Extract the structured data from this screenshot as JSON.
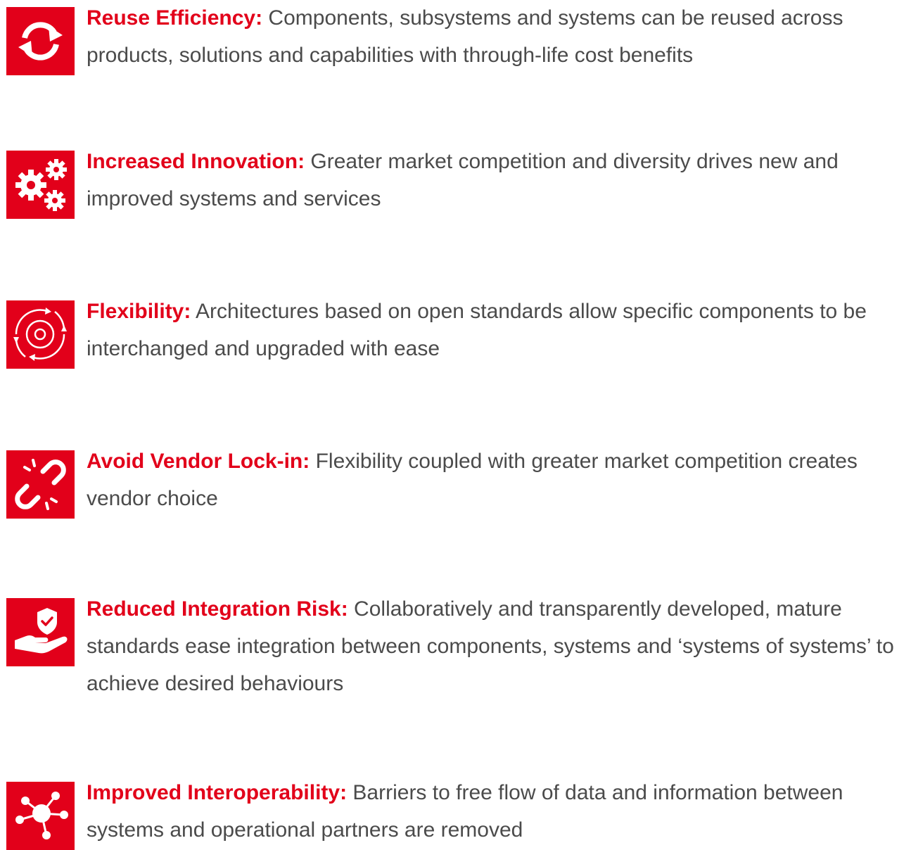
{
  "accent_color": "#e2001a",
  "body_text_color": "#4b4b4b",
  "items": [
    {
      "icon": "refresh-arrows-icon",
      "title": "Reuse Efficiency:",
      "body": " Components, subsystems and systems can be reused across products, solutions and capabilities with through-life cost benefits"
    },
    {
      "icon": "gears-icon",
      "title": "Increased Innovation:",
      "body": " Greater market competition and diversity drives new and improved systems and services"
    },
    {
      "icon": "gear-cycle-icon",
      "title": "Flexibility:",
      "body": " Architectures based on open standards allow specific components to be interchanged and upgraded with ease"
    },
    {
      "icon": "broken-link-icon",
      "title": "Avoid Vendor Lock-in:",
      "body": " Flexibility coupled with greater market competition creates vendor choice"
    },
    {
      "icon": "hand-shield-icon",
      "title": "Reduced Integration Risk:",
      "body": " Collaboratively and transparently developed, mature standards ease integration between components, systems and ‘systems of systems’ to achieve desired behaviours"
    },
    {
      "icon": "network-hub-icon",
      "title": "Improved Interoperability:",
      "body": " Barriers to free flow of data and information between systems and operational partners are removed"
    }
  ]
}
